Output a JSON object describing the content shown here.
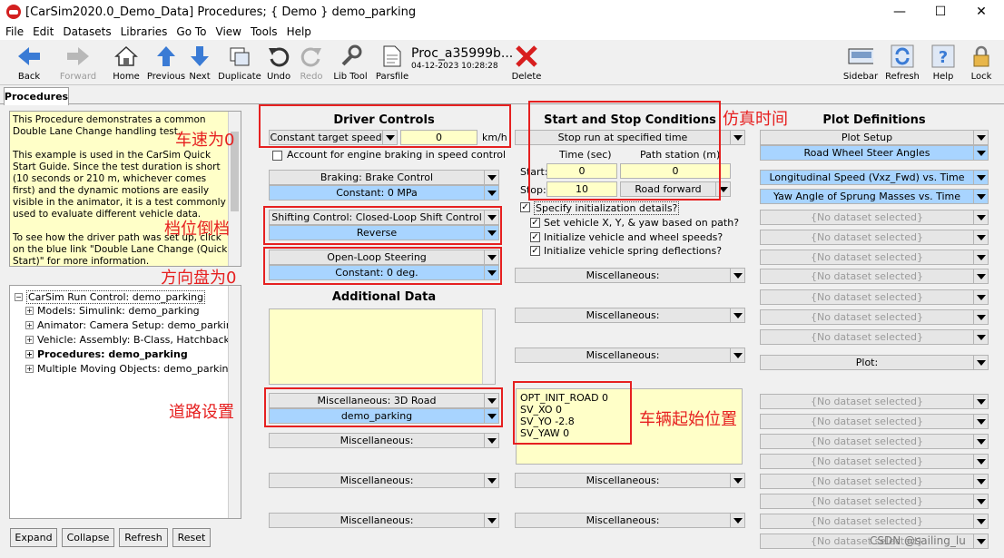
{
  "window": {
    "title": "[CarSim2020.0_Demo_Data] Procedures; { Demo } demo_parking",
    "minimize": "—",
    "maximize": "☐",
    "close": "✕"
  },
  "menu": [
    "File",
    "Edit",
    "Datasets",
    "Libraries",
    "Go To",
    "View",
    "Tools",
    "Help"
  ],
  "toolbar": {
    "back": "Back",
    "forward": "Forward",
    "home": "Home",
    "previous": "Previous",
    "next": "Next",
    "duplicate": "Duplicate",
    "undo": "Undo",
    "redo": "Redo",
    "lib_tool": "Lib Tool",
    "parsfile": "Parsfile",
    "dataset_name": "Proc_a35999b...",
    "dataset_date": "04-12-2023 10:28:28",
    "delete": "Delete",
    "sidebar": "Sidebar",
    "refresh": "Refresh",
    "help": "Help",
    "lock": "Lock"
  },
  "tabs": {
    "procedures": "Procedures"
  },
  "description": "This Procedure demonstrates a common Double Lane Change handling test.\n\nThis example is used in the CarSim Quick Start Guide. Since the test duration is short (10 seconds or 210 m, whichever comes first) and the dynamic motions are easily visible in the animator, it is a test commonly used to evaluate different vehicle data.\n\nTo see how the driver path was set up, click on the blue link \"Double Lane Change (Quick Start)\" for more information.",
  "tree": {
    "root": "CarSim Run Control: demo_parking",
    "children": [
      "Models: Simulink: demo_parking",
      "Animator: Camera Setup: demo_parking",
      "Vehicle: Assembly: B-Class, Hatchback",
      "Procedures: demo_parking",
      "Multiple Moving Objects: demo_parking"
    ]
  },
  "bottom_buttons": {
    "expand": "Expand",
    "collapse": "Collapse",
    "refresh": "Refresh",
    "reset": "Reset"
  },
  "driver": {
    "header": "Driver Controls",
    "speed_mode": "Constant target speed",
    "speed_value": "0",
    "speed_unit": "km/h",
    "engine_braking": "Account for engine braking in speed control",
    "braking": "Braking: Brake Control",
    "braking_value": "Constant: 0 MPa",
    "shifting": "Shifting Control: Closed-Loop Shift Control",
    "shifting_value": "Reverse",
    "steering": "Open-Loop Steering",
    "steering_value": "Constant: 0 deg.",
    "additional_header": "Additional Data",
    "road": "Miscellaneous: 3D Road",
    "road_value": "demo_parking",
    "misc": "Miscellaneous:"
  },
  "start_stop": {
    "header": "Start and Stop Conditions",
    "mode": "Stop run at specified time",
    "col_time": "Time (sec)",
    "col_station": "Path station (m)",
    "start_label": "Start:",
    "start_time": "0",
    "start_station": "0",
    "stop_label": "Stop:",
    "stop_time": "10",
    "stop_direction": "Road forward",
    "specify_init": "Specify initialization details?",
    "set_xy": "Set vehicle X, Y, & yaw based on path?",
    "init_wheels": "Initialize vehicle and wheel speeds?",
    "init_springs": "Initialize vehicle spring deflections?",
    "misc": "Miscellaneous:",
    "init_text": "OPT_INIT_ROAD 0\nSV_XO 0\nSV_YO -2.8\nSV_YAW 0"
  },
  "plot": {
    "header": "Plot Definitions",
    "setup": "Plot Setup",
    "setup_value": "Road Wheel Steer Angles",
    "plot1": "Longitudinal Speed (Vxz_Fwd) vs. Time",
    "plot2": "Yaw Angle of Sprung Masses vs. Time",
    "none": "{No dataset selected}",
    "plot_label": "Plot:"
  },
  "annotations": {
    "speed": "车速为0",
    "gear": "档位倒档",
    "steer": "方向盘为0",
    "road": "道路设置",
    "sim_time": "仿真时间",
    "start_pos": "车辆起始位置"
  },
  "watermark": "CSDN @sailing_lu"
}
